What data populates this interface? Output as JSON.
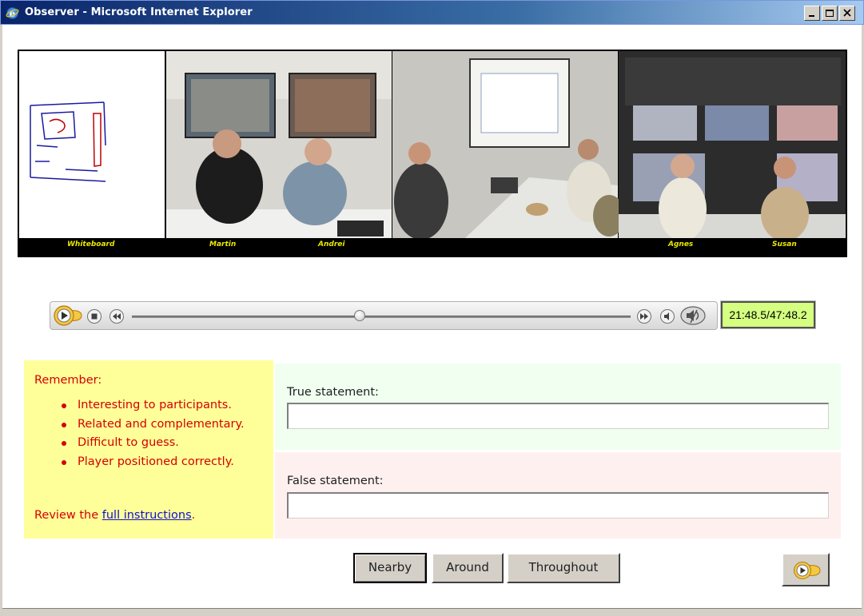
{
  "window": {
    "title": "Observer - Microsoft Internet Explorer"
  },
  "panorama": {
    "labels": [
      "Whiteboard",
      "Martin",
      "Andrei",
      "Agnes",
      "Susan"
    ]
  },
  "player": {
    "time": "21:48.5/47:48.2",
    "progress": 0.457
  },
  "reminder": {
    "heading": "Remember:",
    "items": [
      "Interesting to participants.",
      "Related and complementary.",
      "Difficult to guess.",
      "Player positioned correctly."
    ],
    "review_prefix": "Review the ",
    "review_link": "full instructions",
    "review_suffix": "."
  },
  "form": {
    "true_label": "True statement:",
    "true_value": "",
    "false_label": "False statement:",
    "false_value": ""
  },
  "buttons": {
    "nearby": "Nearby",
    "around": "Around",
    "throughout": "Throughout"
  },
  "colors": {
    "titlebar": "#0a246a",
    "reminder_bg": "#ffff99",
    "reminder_text": "#d40000",
    "true_panel": "#f0fff0",
    "false_panel": "#fff0f0",
    "timebox": "#d4ff80"
  },
  "icons": {
    "app": "ie-icon",
    "minimize": "minimize-icon",
    "maximize": "maximize-icon",
    "close": "close-icon",
    "play": "play-icon",
    "stop": "stop-icon",
    "rewind": "rewind-icon",
    "fastforward": "fast-forward-icon",
    "volume": "volume-icon",
    "mute": "mute-icon",
    "next": "next-play-icon"
  }
}
